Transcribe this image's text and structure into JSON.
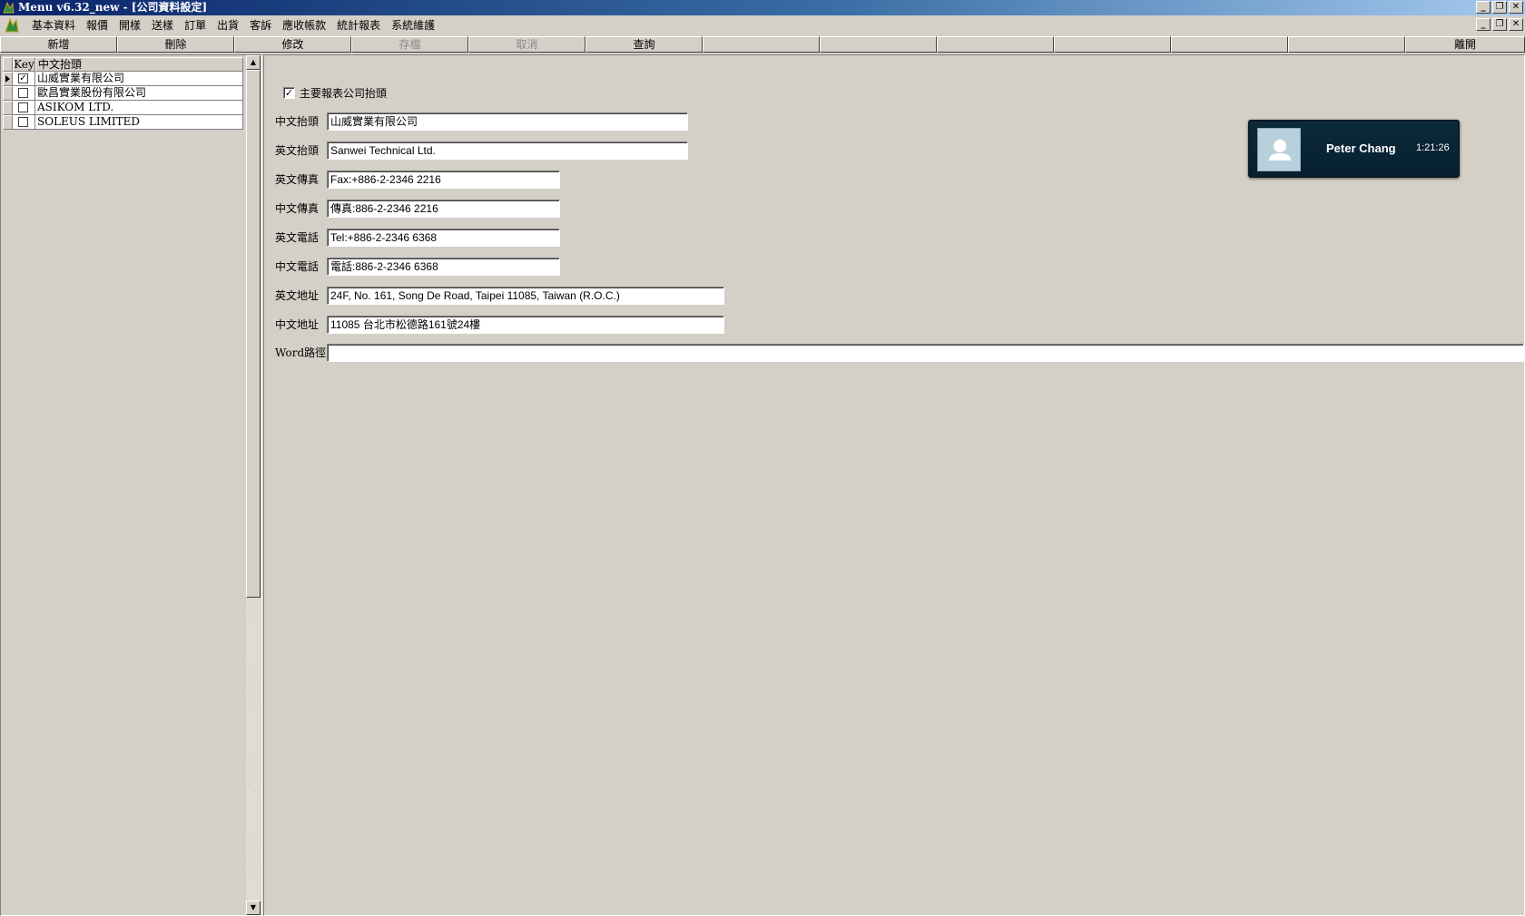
{
  "window": {
    "title": "Menu v6.32_new - [公司資料設定]"
  },
  "menu": {
    "items": [
      "基本資料",
      "報價",
      "開樣",
      "送樣",
      "訂單",
      "出貨",
      "客訴",
      "應收帳款",
      "統計報表",
      "系統維護"
    ]
  },
  "toolbar": {
    "buttons": [
      {
        "label": "新增",
        "enabled": true
      },
      {
        "label": "刪除",
        "enabled": true
      },
      {
        "label": "修改",
        "enabled": true
      },
      {
        "label": "存檔",
        "enabled": false
      },
      {
        "label": "取消",
        "enabled": false
      },
      {
        "label": "查詢",
        "enabled": true
      },
      {
        "label": "",
        "enabled": true
      },
      {
        "label": "",
        "enabled": true
      },
      {
        "label": "",
        "enabled": true
      },
      {
        "label": "",
        "enabled": true
      },
      {
        "label": "",
        "enabled": true
      },
      {
        "label": "",
        "enabled": true
      },
      {
        "label": "離開",
        "enabled": true
      }
    ]
  },
  "grid": {
    "columns": [
      "Key",
      "中文抬頭"
    ],
    "rows": [
      {
        "key_checked": true,
        "name": "山威實業有限公司",
        "current": true
      },
      {
        "key_checked": false,
        "name": "歐昌實業股份有限公司",
        "current": false
      },
      {
        "key_checked": false,
        "name": "ASIKOM LTD.",
        "current": false
      },
      {
        "key_checked": false,
        "name": "SOLEUS LIMITED",
        "current": false
      }
    ]
  },
  "form": {
    "primary_checkbox": {
      "label": "主要報表公司抬頭",
      "checked": true
    },
    "fields": [
      {
        "label": "中文抬頭",
        "value": "山威實業有限公司"
      },
      {
        "label": "英文抬頭",
        "value": "Sanwei Technical Ltd."
      },
      {
        "label": "英文傳真",
        "value": "Fax:+886-2-2346 2216"
      },
      {
        "label": "中文傳真",
        "value": "傳真:886-2-2346 2216"
      },
      {
        "label": "英文電話",
        "value": "Tel:+886-2-2346 6368"
      },
      {
        "label": "中文電話",
        "value": "電話:886-2-2346 6368"
      },
      {
        "label": "英文地址",
        "value": "24F, No. 161, Song De Road, Taipei 11085, Taiwan (R.O.C.)"
      },
      {
        "label": "中文地址",
        "value": "11085 台北市松德路161號24樓"
      },
      {
        "label": "Word路徑",
        "value": ""
      }
    ]
  },
  "call_popup": {
    "name": "Peter Chang",
    "time": "1:21:26"
  },
  "icons": {
    "app": "app-logo-icon",
    "minimize": "minimize-icon",
    "restore": "restore-icon",
    "close": "close-icon"
  }
}
